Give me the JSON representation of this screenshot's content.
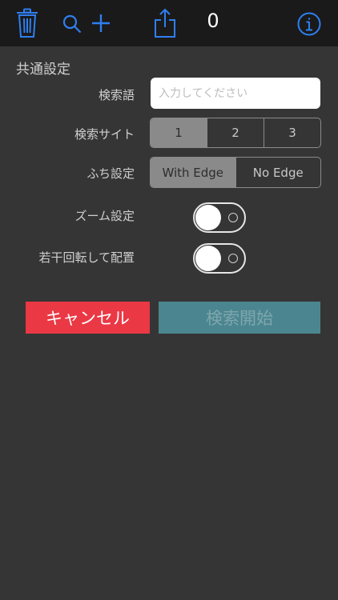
{
  "toolbar": {
    "count": "0",
    "icons": [
      "trash-icon",
      "search-icon",
      "plus-icon",
      "share-icon",
      "info-icon"
    ],
    "accent_color": "#2f7ff0"
  },
  "settings": {
    "section_title": "共通設定",
    "search_term": {
      "label": "検索語",
      "value": "",
      "placeholder": "入力してください"
    },
    "search_site": {
      "label": "検索サイト",
      "options": [
        "1",
        "2",
        "3"
      ],
      "selected": "1"
    },
    "edge": {
      "label": "ふち設定",
      "options": [
        "With Edge",
        "No Edge"
      ],
      "selected": "With Edge"
    },
    "zoom": {
      "label": "ズーム設定",
      "state": "off"
    },
    "rotate": {
      "label": "若干回転して配置",
      "state": "off"
    }
  },
  "actions": {
    "cancel_label": "キャンセル",
    "start_label": "検索開始",
    "cancel_color": "#ea3845",
    "start_color": "#4b8690"
  }
}
